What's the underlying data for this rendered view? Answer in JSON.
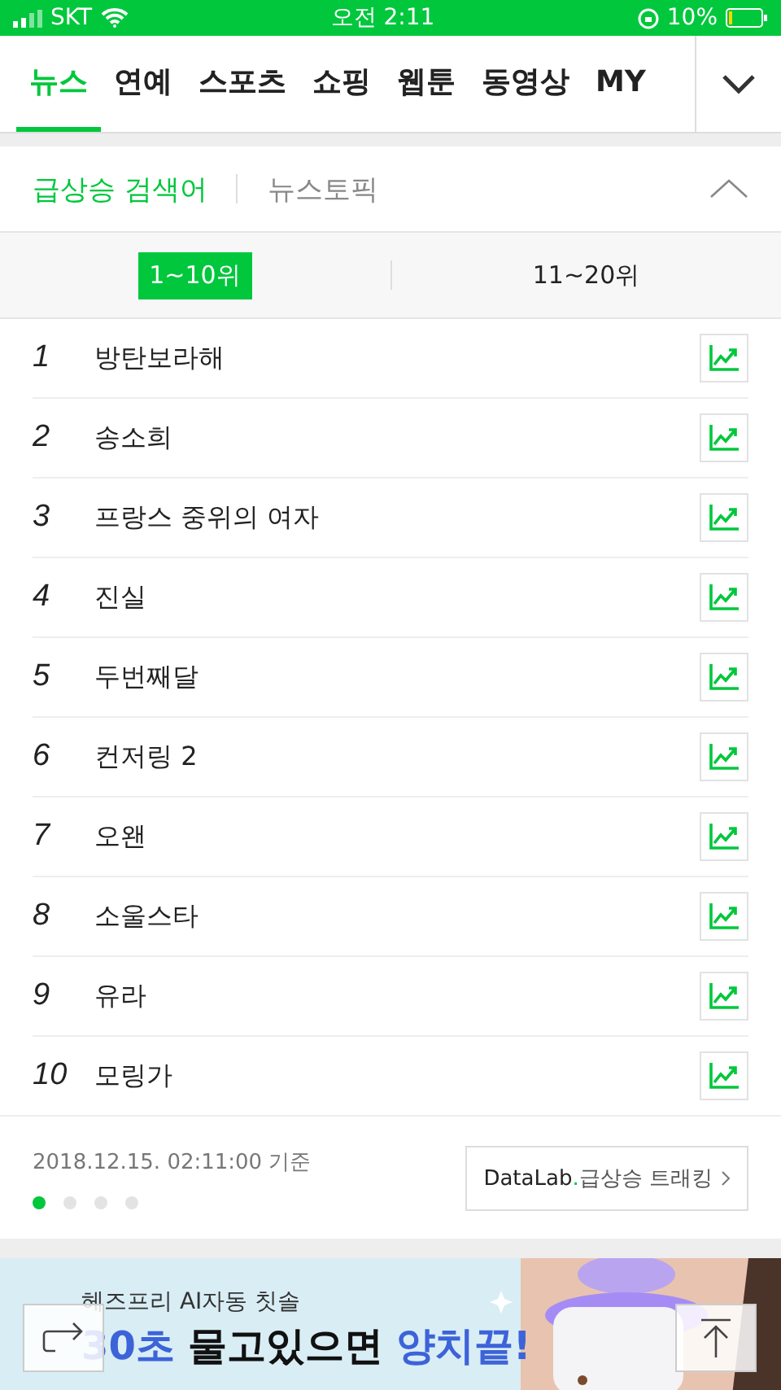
{
  "status_bar": {
    "carrier": "SKT",
    "time": "오전 2:11",
    "battery": "10%"
  },
  "nav_tabs": [
    {
      "label": "뉴스",
      "selected": true
    },
    {
      "label": "연예",
      "selected": false
    },
    {
      "label": "스포츠",
      "selected": false
    },
    {
      "label": "쇼핑",
      "selected": false
    },
    {
      "label": "웹툰",
      "selected": false
    },
    {
      "label": "동영상",
      "selected": false
    },
    {
      "label": "MY",
      "selected": false
    }
  ],
  "section_tabs": [
    {
      "label": "급상승 검색어",
      "selected": true
    },
    {
      "label": "뉴스토픽",
      "selected": false
    }
  ],
  "range_tabs": [
    {
      "label": "1~10위",
      "selected": true
    },
    {
      "label": "11~20위",
      "selected": false
    }
  ],
  "ranking": [
    {
      "rank": "1",
      "keyword": "방탄보라해"
    },
    {
      "rank": "2",
      "keyword": "송소희"
    },
    {
      "rank": "3",
      "keyword": "프랑스 중위의 여자"
    },
    {
      "rank": "4",
      "keyword": "진실"
    },
    {
      "rank": "5",
      "keyword": "두번째달"
    },
    {
      "rank": "6",
      "keyword": "컨저링 2"
    },
    {
      "rank": "7",
      "keyword": "오왠"
    },
    {
      "rank": "8",
      "keyword": "소울스타"
    },
    {
      "rank": "9",
      "keyword": "유라"
    },
    {
      "rank": "10",
      "keyword": "모링가"
    }
  ],
  "timestamp": "2018.12.15. 02:11:00 기준",
  "pages": [
    {
      "selected": true
    },
    {
      "selected": false
    },
    {
      "selected": false
    },
    {
      "selected": false
    }
  ],
  "datalab_button": {
    "brand": "DataLab",
    "dot": ".",
    "label": "급상승 트래킹"
  },
  "ad": {
    "kind": "picture",
    "subtitle": "헤즈프리 AI자동 칫솔",
    "headline_parts": [
      {
        "text": "30초",
        "accent": true
      },
      {
        "text": "물고있으면",
        "accent": false
      },
      {
        "text": "양치끝!",
        "accent": true
      }
    ]
  }
}
